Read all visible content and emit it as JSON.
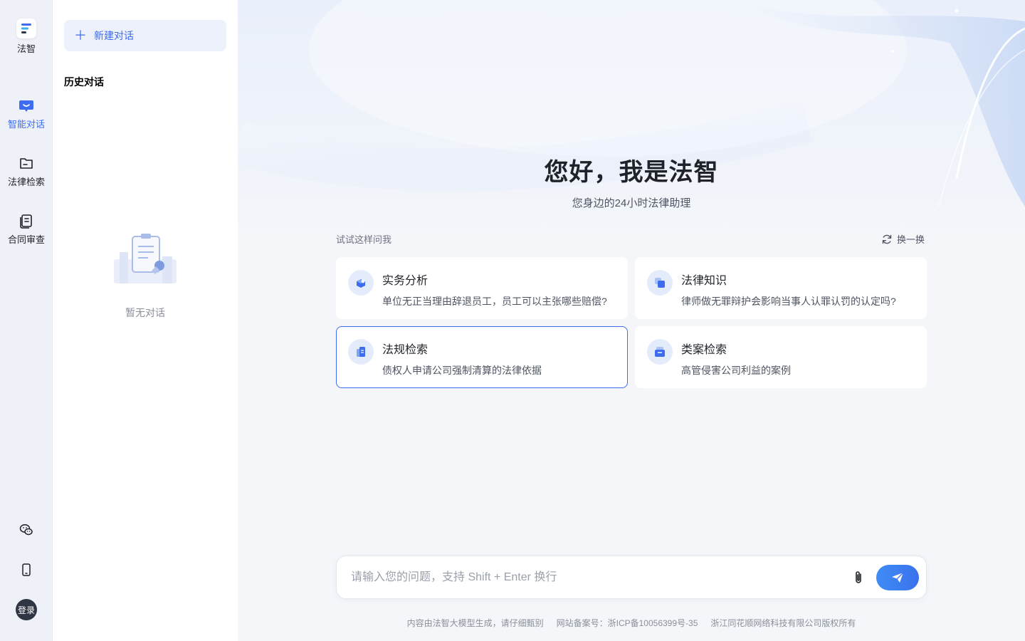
{
  "rail": {
    "logo_label": "法智",
    "items": [
      {
        "label": "智能对话",
        "icon": "chat-bubble-icon",
        "active": true
      },
      {
        "label": "法律检索",
        "icon": "folder-icon",
        "active": false
      },
      {
        "label": "合同审查",
        "icon": "contract-icon",
        "active": false
      }
    ],
    "bottom": {
      "wechat_icon": "wechat-icon",
      "mobile_icon": "mobile-icon",
      "login_label": "登录"
    }
  },
  "history": {
    "new_chat_label": "新建对话",
    "title": "历史对话",
    "empty_text": "暂无对话"
  },
  "hero": {
    "title": "您好，我是法智",
    "subtitle": "您身边的24小时法律助理"
  },
  "suggestions": {
    "label": "试试这样问我",
    "refresh_label": "换一换",
    "cards": [
      {
        "title": "实务分析",
        "desc": "单位无正当理由辞退员工，员工可以主张哪些赔偿?",
        "icon": "analysis-icon"
      },
      {
        "title": "法律知识",
        "desc": "律师做无罪辩护会影响当事人认罪认罚的认定吗?",
        "icon": "knowledge-icon"
      },
      {
        "title": "法规检索",
        "desc": "债权人申请公司强制清算的法律依据",
        "icon": "regulation-icon",
        "selected": true
      },
      {
        "title": "类案检索",
        "desc": "高管侵害公司利益的案例",
        "icon": "case-icon"
      }
    ]
  },
  "composer": {
    "placeholder": "请输入您的问题，支持 Shift + Enter 换行",
    "value": ""
  },
  "footer": {
    "notice": "内容由法智大模型生成，请仔细甄别",
    "icp": "网站备案号：浙ICP备10056399号-35",
    "copyright": "浙江同花顺网络科技有限公司版权所有"
  },
  "colors": {
    "accent": "#3d6cf0",
    "send_gradient_start": "#3f8cf5",
    "send_gradient_end": "#3a72ec"
  }
}
